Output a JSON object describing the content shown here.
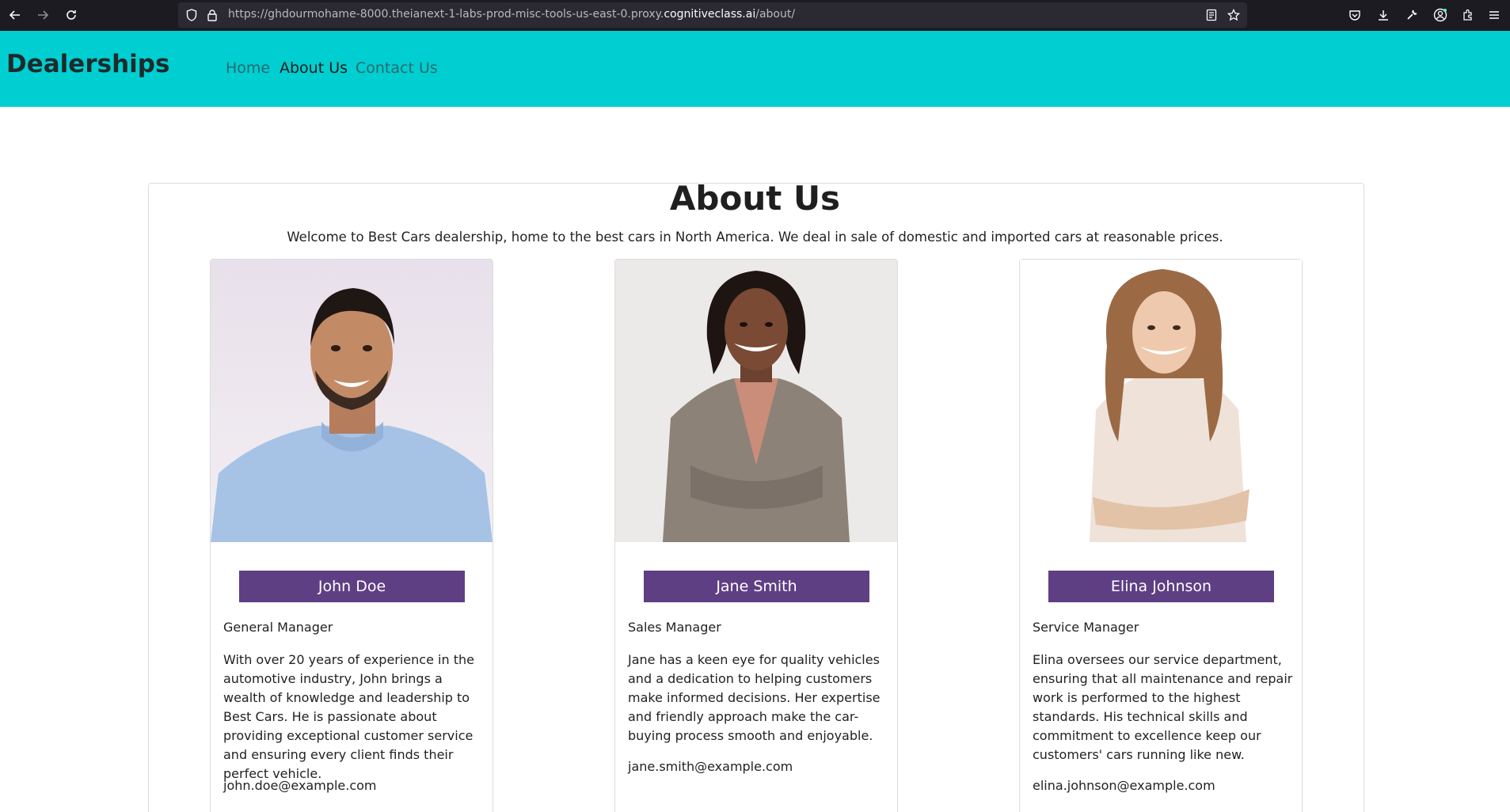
{
  "browser": {
    "url_prefix": "https://ghdourmohame-8000.theianext-1-labs-prod-misc-tools-us-east-0.proxy.",
    "url_domain": "cognitiveclass.ai",
    "url_suffix": "/about/"
  },
  "navbar": {
    "brand": "Dealerships",
    "links": [
      {
        "label": "Home",
        "active": false
      },
      {
        "label": "About Us",
        "active": true
      },
      {
        "label": "Contact Us",
        "active": false
      }
    ],
    "background": "#00ced1"
  },
  "main": {
    "title": "About Us",
    "intro": "Welcome to Best Cars dealership, home to the best cars in North America. We deal in sale of domestic and imported cars at reasonable prices."
  },
  "team": [
    {
      "name": "John Doe",
      "role": "General Manager",
      "bio": "With over 20 years of experience in the automotive industry, John brings a wealth of knowledge and leadership to Best Cars. He is passionate about providing exceptional customer service and ensuring every client finds their perfect vehicle.",
      "email": "john.doe@example.com"
    },
    {
      "name": "Jane Smith",
      "role": "Sales Manager",
      "bio": "Jane has a keen eye for quality vehicles and a dedication to helping customers make informed decisions. Her expertise and friendly approach make the car-buying process smooth and enjoyable.",
      "email": "jane.smith@example.com"
    },
    {
      "name": "Elina Johnson",
      "role": "Service Manager",
      "bio": "Elina oversees our service department, ensuring that all maintenance and repair work is performed to the highest standards. His technical skills and commitment to excellence keep our customers' cars running like new.",
      "email": "elina.johnson@example.com"
    }
  ],
  "colors": {
    "name_bar": "#5f3f84",
    "browser_chrome": "#1c1b22"
  }
}
